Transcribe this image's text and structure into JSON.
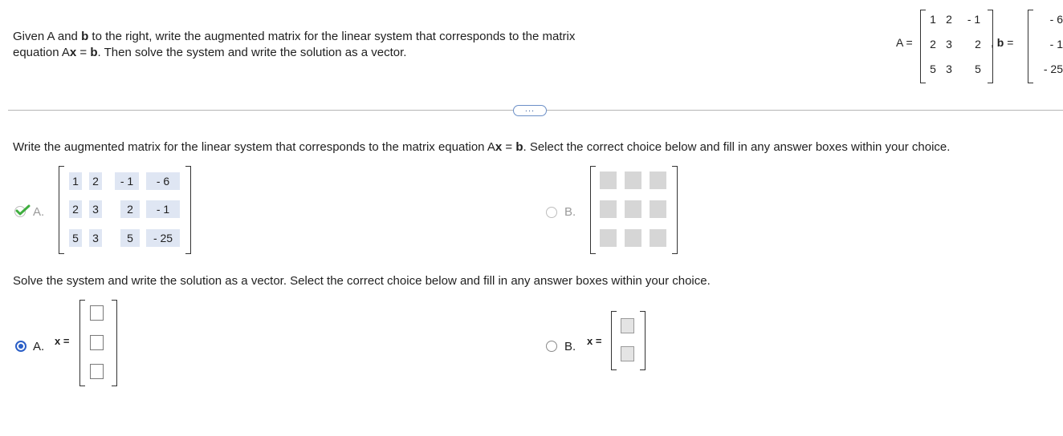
{
  "problem": {
    "prompt_line1": "Given A and b to the right, write the augmented matrix for the linear system that corresponds to the matrix",
    "prompt_line2": "equation Ax = b. Then solve the system and write the solution as a vector."
  },
  "given": {
    "a_label": "A =",
    "b_label": ", b =",
    "A": [
      [
        "1",
        "2",
        "- 1"
      ],
      [
        "2",
        "3",
        "2"
      ],
      [
        "5",
        "3",
        "5"
      ]
    ],
    "b": [
      "- 6",
      "- 1",
      "- 25"
    ]
  },
  "more_button": "...",
  "part1": {
    "question": "Write the augmented matrix for the linear system that corresponds to the matrix equation Ax = b. Select the correct choice below and fill in any answer boxes within your choice.",
    "option_a_label": "A.",
    "option_b_label": "B.",
    "augmented": [
      [
        "1",
        "2",
        "- 1",
        "- 6"
      ],
      [
        "2",
        "3",
        "2",
        "- 1"
      ],
      [
        "5",
        "3",
        "5",
        "- 25"
      ]
    ],
    "option_a_status": "correct"
  },
  "part2": {
    "question": "Solve the system and write the solution as a vector. Select the correct choice below and fill in any answer boxes within your choice.",
    "option_a_label": "A.",
    "option_b_label": "B.",
    "x_label": "x =",
    "selected": "A"
  },
  "colors": {
    "accent": "#2b5fc7",
    "correct_check": "#3fae3f",
    "shade": "#dfe6f3"
  }
}
